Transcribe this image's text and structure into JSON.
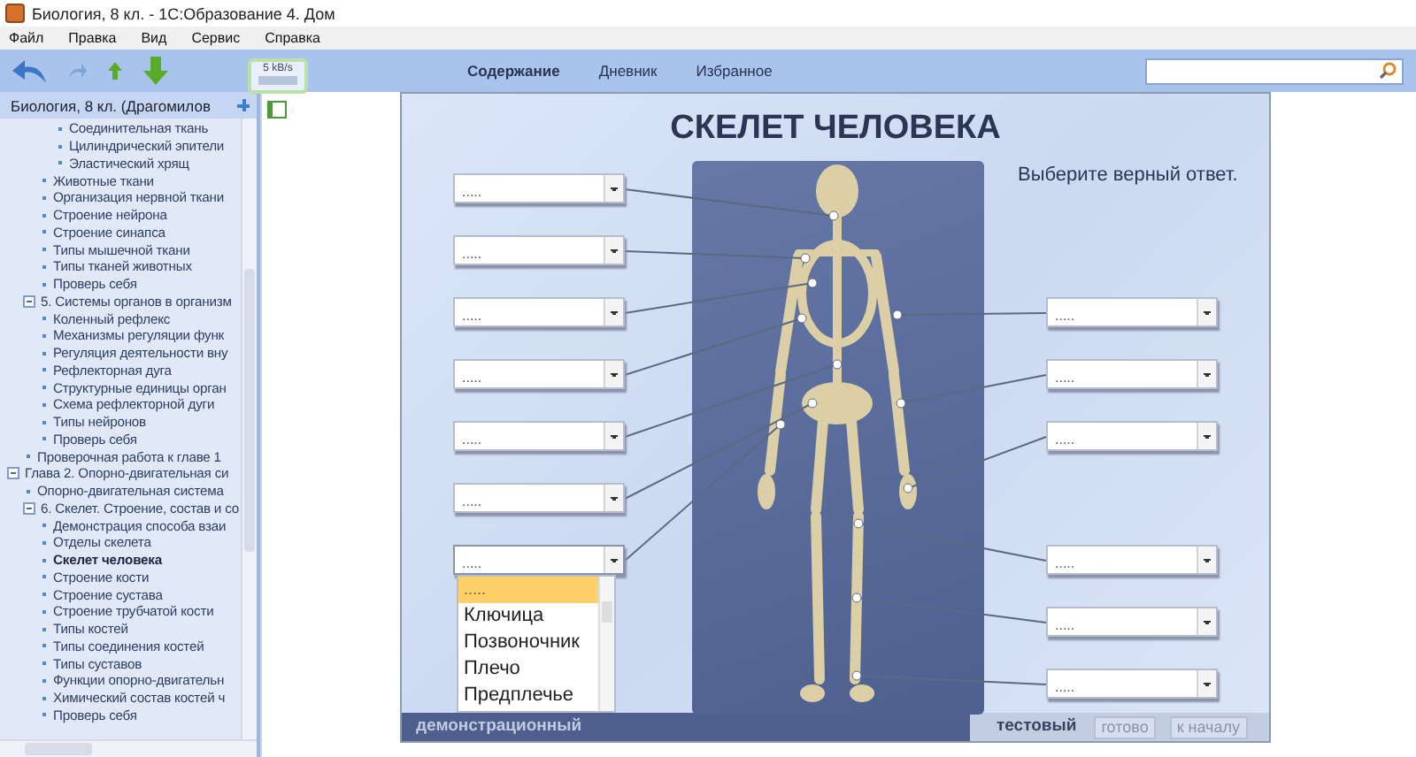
{
  "window": {
    "title": "Биология, 8 кл. - 1С:Образование 4. Дом"
  },
  "menu": [
    "Файл",
    "Правка",
    "Вид",
    "Сервис",
    "Справка"
  ],
  "net_meter": {
    "rate": "5 kB/s"
  },
  "sidebar": {
    "title": "Биология, 8 кл. (Драгомилов",
    "tree": [
      {
        "children": [
          {
            "children": [
              {
                "children": [
                  {
                    "label": "Соединительная ткань",
                    "selected": false
                  },
                  {
                    "label": "Цилиндрический эпители",
                    "selected": false
                  },
                  {
                    "label": "Эластический хрящ",
                    "selected": false
                  }
                ]
              },
              {
                "label": "Животные ткани",
                "selected": false
              },
              {
                "label": "Организация нервной ткани",
                "selected": false
              },
              {
                "label": "Строение нейрона",
                "selected": false
              },
              {
                "label": "Строение синапса",
                "selected": false
              },
              {
                "label": "Типы мышечной ткани",
                "selected": false
              },
              {
                "label": "Типы тканей животных",
                "selected": false
              },
              {
                "label": "Проверь себя",
                "selected": false
              }
            ]
          },
          {
            "label": "5. Системы органов в организм",
            "selected": false,
            "expanded": true,
            "children": [
              {
                "label": "Коленный рефлекс",
                "selected": false
              },
              {
                "label": "Механизмы регуляции функ",
                "selected": false
              },
              {
                "label": "Регуляция деятельности вну",
                "selected": false
              },
              {
                "label": "Рефлекторная дуга",
                "selected": false
              },
              {
                "label": "Структурные единицы орган",
                "selected": false
              },
              {
                "label": "Схема рефлекторной дуги",
                "selected": false
              },
              {
                "label": "Типы нейронов",
                "selected": false
              },
              {
                "label": "Проверь себя",
                "selected": false
              }
            ]
          },
          {
            "label": "Проверочная работа к главе 1",
            "selected": false
          }
        ]
      },
      {
        "label": "Глава 2. Опорно-двигательная си",
        "selected": false,
        "expanded": true,
        "children": [
          {
            "label": "Опорно-двигательная система",
            "selected": false
          },
          {
            "label": "6. Скелет. Строение, состав и со",
            "selected": false,
            "expanded": true,
            "children": [
              {
                "label": "Демонстрация способа взаи",
                "selected": false
              },
              {
                "label": "Отделы скелета",
                "selected": false
              },
              {
                "label": "Скелет человека",
                "selected": true
              },
              {
                "label": "Строение кости",
                "selected": false
              },
              {
                "label": "Строение сустава",
                "selected": false
              },
              {
                "label": "Строение трубчатой кости",
                "selected": false
              },
              {
                "label": "Типы костей",
                "selected": false
              },
              {
                "label": "Типы соединения костей",
                "selected": false
              },
              {
                "label": "Типы суставов",
                "selected": false
              },
              {
                "label": "Функции опорно-двигательн",
                "selected": false
              },
              {
                "label": "Химический состав костей ч",
                "selected": false
              },
              {
                "label": "Проверь себя",
                "selected": false
              }
            ]
          }
        ]
      }
    ]
  },
  "tabs": [
    {
      "label": "Содержание",
      "selected": true
    },
    {
      "label": "Дневник",
      "selected": false
    },
    {
      "label": "Избранное",
      "selected": false
    }
  ],
  "exercise": {
    "title": "СКЕЛЕТ ЧЕЛОВЕКА",
    "instruction": "Выберите верный ответ.",
    "left_fields": [
      {
        "value": "....."
      },
      {
        "value": "....."
      },
      {
        "value": "....."
      },
      {
        "value": "....."
      },
      {
        "value": "....."
      },
      {
        "value": "....."
      },
      {
        "value": ".....",
        "expanded": true,
        "options": [
          {
            "label": ".....",
            "selected": true
          },
          {
            "label": "Ключица",
            "selected": false
          },
          {
            "label": "Позвоночник",
            "selected": false
          },
          {
            "label": "Плечо",
            "selected": false
          },
          {
            "label": "Предплечье",
            "selected": false
          }
        ]
      }
    ],
    "right_fields": [
      {
        "value": "....."
      },
      {
        "value": "....."
      },
      {
        "value": "....."
      },
      {
        "value": "....."
      },
      {
        "value": "....."
      },
      {
        "value": "....."
      }
    ],
    "modes": [
      {
        "label": "демонстрационный",
        "selected": false
      },
      {
        "label": "тестовый",
        "selected": true
      }
    ],
    "buttons": [
      "готово",
      "к началу"
    ]
  }
}
